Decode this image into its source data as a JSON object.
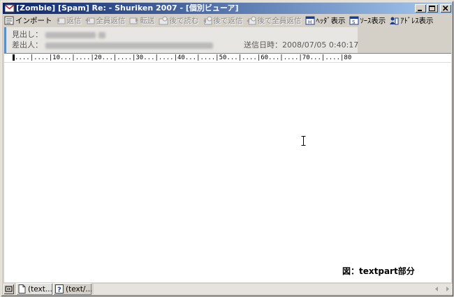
{
  "window": {
    "title": "[Zombie] [Spam]  Re: - Shuriken 2007 - [個別ビューア]"
  },
  "toolbar": {
    "items": [
      {
        "label": "インポート",
        "icon": "import-icon",
        "enabled": true
      },
      {
        "label": "返信",
        "icon": "reply-icon",
        "enabled": false
      },
      {
        "label": "全員返信",
        "icon": "reply-all-icon",
        "enabled": false
      },
      {
        "label": "転送",
        "icon": "forward-icon",
        "enabled": false
      },
      {
        "label": "後で読む",
        "icon": "read-later-icon",
        "enabled": false
      },
      {
        "label": "後で返信",
        "icon": "reply-later-icon",
        "enabled": false
      },
      {
        "label": "後で全員返信",
        "icon": "reply-all-later-icon",
        "enabled": false
      },
      {
        "label": "ﾍｯﾀﾞ表示",
        "icon": "header-view-icon",
        "enabled": true
      },
      {
        "label": "ｿｰｽ表示",
        "icon": "source-view-icon",
        "enabled": true
      },
      {
        "label": "ｱﾄﾞﾚｽ表示",
        "icon": "address-view-icon",
        "enabled": true
      }
    ]
  },
  "header": {
    "subject_label": "見出し：",
    "sender_label": "差出人：",
    "sent_label": "送信日時：",
    "sent_value": "2008/07/05 0:40:17"
  },
  "ruler": {
    "text": "....|....|10...|....|20...|....|30...|....|40...|....|50...|....|60...|....|70...|....|80"
  },
  "caption": {
    "text": "図：textpart部分"
  },
  "tabs": [
    {
      "label": "(text...",
      "icon": "document-icon"
    },
    {
      "label": "(text/...",
      "icon": "help-icon"
    }
  ],
  "colors": {
    "title_gradient_start": "#0a246a",
    "title_gradient_end": "#a6caf0",
    "header_accent": "#5a8fc8"
  }
}
